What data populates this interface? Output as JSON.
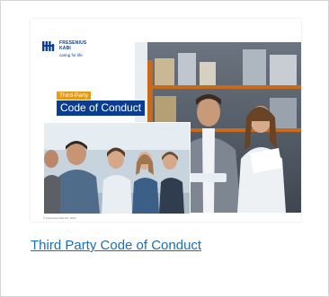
{
  "cover": {
    "logo_name_line1": "FRESENIUS",
    "logo_name_line2": "KABI",
    "logo_tagline": "caring for life",
    "badge_subtitle": "Third-Party",
    "badge_title": "Code of Conduct",
    "copyright": "© Fresenius Kabi AG, 2022"
  },
  "link": {
    "label": "Third Party Code of Conduct"
  },
  "colors": {
    "brand_blue": "#0a3d8f",
    "accent_orange": "#e69a12",
    "link_blue": "#1a6fb5"
  }
}
